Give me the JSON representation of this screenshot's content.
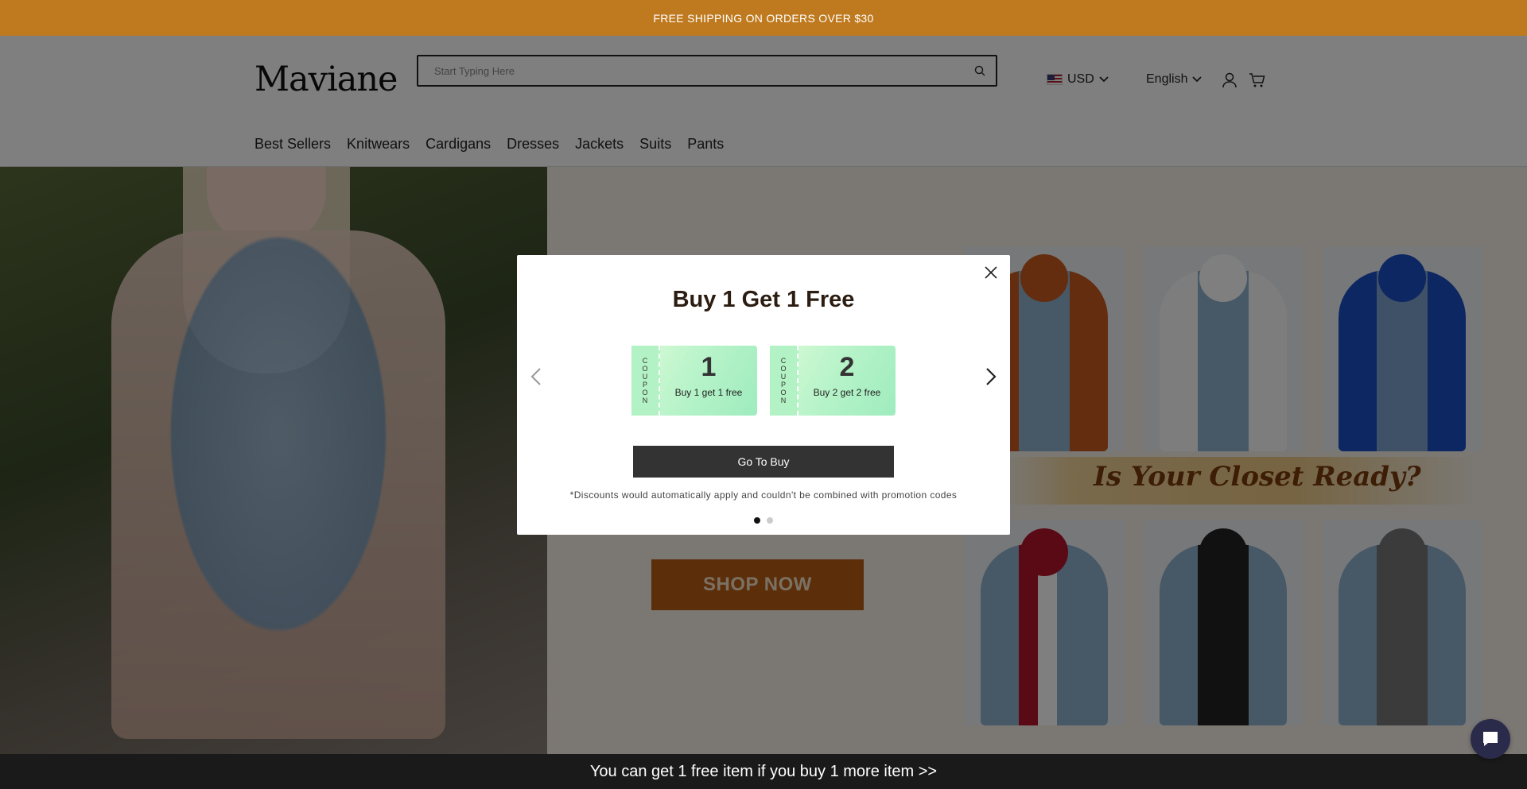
{
  "announcement": "FREE SHIPPING ON ORDERS OVER $30",
  "header": {
    "logo": "Maviane",
    "search_placeholder": "Start Typing Here",
    "currency": "USD",
    "language": "English"
  },
  "nav": {
    "items": [
      "Best Sellers",
      "Knitwears",
      "Cardigans",
      "Dresses",
      "Jackets",
      "Suits",
      "Pants"
    ]
  },
  "hero": {
    "headline": "Is Your Closet Ready?",
    "cta": "SHOP NOW"
  },
  "modal": {
    "title": "Buy 1 Get 1 Free",
    "coupon_side_label": "COUPON",
    "coupons": [
      {
        "number": "1",
        "desc": "Buy 1 get 1 free"
      },
      {
        "number": "2",
        "desc": "Buy 2 get 2 free"
      }
    ],
    "button": "Go To Buy",
    "disclaimer": "*Discounts would automatically apply and couldn't be combined with promotion codes",
    "active_slide": 1,
    "slide_count": 2
  },
  "bottom_bar": "You can get 1 free item if you buy 1 more item  >>",
  "colors": {
    "announce_bg": "#bf7a1f",
    "coupon_green": "#b7f3c9",
    "button_dark": "#333333"
  }
}
